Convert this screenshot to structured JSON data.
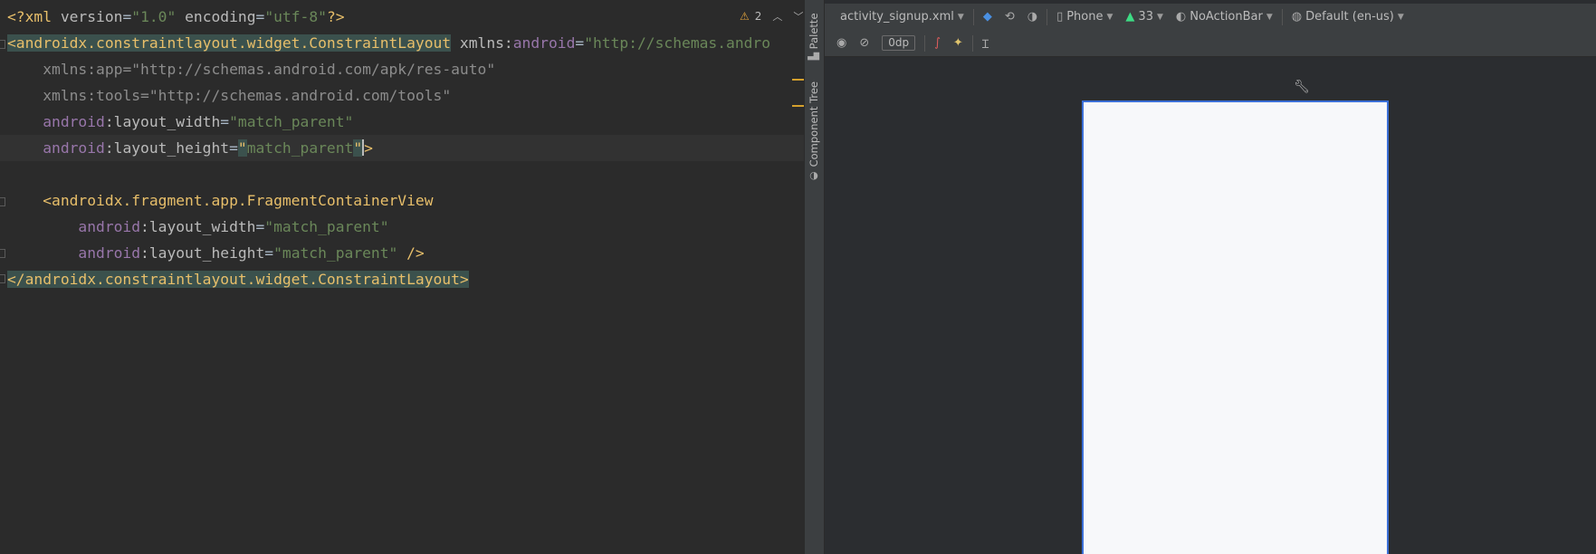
{
  "editor": {
    "lines": {
      "l1": {
        "open": "<?xml ",
        "k1": "version",
        "v1": "\"1.0\"",
        "k2": "encoding",
        "v2": "\"utf-8\"",
        "close": "?>"
      },
      "l2": {
        "tag": "<androidx.constraintlayout.widget.ConstraintLayout",
        "ns": "xmlns:",
        "nsname": "android",
        "eq": "=",
        "val": "\"http://schemas.andro"
      },
      "l3": {
        "text": "xmlns:app=\"http://schemas.android.com/apk/res-auto\""
      },
      "l4": {
        "text": "xmlns:tools=\"http://schemas.android.com/tools\""
      },
      "l5": {
        "ns": "android",
        "attr": ":layout_width",
        "eq": "=",
        "val": "\"match_parent\""
      },
      "l6": {
        "ns": "android",
        "attr": ":layout_height",
        "eq": "=",
        "q1": "\"",
        "val": "match_parent",
        "q2": "\"",
        "end": ">"
      },
      "l8": {
        "tag": "<androidx.fragment.app.FragmentContainerView"
      },
      "l9": {
        "ns": "android",
        "attr": ":layout_width",
        "eq": "=",
        "val": "\"match_parent\""
      },
      "l10": {
        "ns": "android",
        "attr": ":layout_height",
        "eq": "=",
        "val": "\"match_parent\"",
        "end": " />"
      },
      "l11": {
        "tag": "</androidx.constraintlayout.widget.ConstraintLayout>"
      }
    },
    "inspection": {
      "warning_count": "2"
    }
  },
  "side_tabs": {
    "palette": "Palette",
    "component_tree": "Component Tree"
  },
  "design_toolbar": {
    "file": "activity_signup.xml",
    "device": "Phone",
    "api": "33",
    "theme": "NoActionBar",
    "locale": "Default (en-us)",
    "margin": "0dp"
  },
  "colors": {
    "accent": "#3b6fd6",
    "warning": "#e0a23c",
    "android_green": "#3ddc84"
  }
}
